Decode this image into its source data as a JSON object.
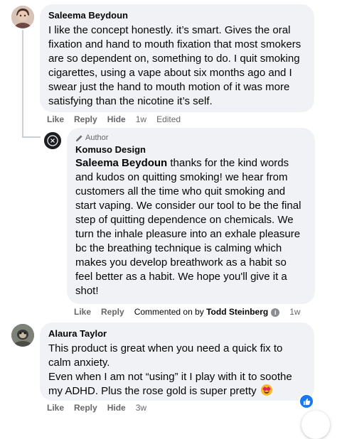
{
  "comments": [
    {
      "author": "Saleema Beydoun",
      "text": "I like the concept honestly. it’s smart. Gives the oral fixation and hand to mouth fixation that most smokers are so dependent on, something to do. I quit smoking cigarettes, using a vape about six months ago and I swear just the hand to mouth motion of it was more satisfying than the nicotine it’s self.",
      "actions": {
        "like": "Like",
        "reply": "Reply",
        "hide": "Hide",
        "time": "1w",
        "edited": "Edited"
      }
    },
    {
      "badge": "Author",
      "author": "Komuso Design",
      "mention": "Saleema Beydoun",
      "text": " thanks for the kind words and kudos on quitting smoking! we hear from customers all the time who quit smoking and start vaping. We consider our tool to be the final step of quitting dependence on chemicals. We turn the inhale pleasure into an exhale pleasure bc the breathing technique is calming which makes you develop breathwork as a habit so feel better as a habit. We hope you'll give it a shot!",
      "actions": {
        "like": "Like",
        "reply": "Reply",
        "commented_on_by": "Commented on by",
        "commenter": "Todd Steinberg",
        "info": "i",
        "time": "1w"
      }
    },
    {
      "author": "Alaura Taylor",
      "text": "This product is great when you need a quick fix to calm anxiety.\nEven when I am not “using” it I play with it to soothe my ADHD. Plus the rose gold is super pretty",
      "emoji": "heart-eyes-emoji",
      "actions": {
        "like": "Like",
        "reply": "Reply",
        "hide": "Hide",
        "time": "3w"
      },
      "reaction": "like"
    }
  ],
  "icons": {
    "pencil": "pencil-icon",
    "info": "info-icon",
    "like_reaction": "thumbs-up-icon",
    "page_logo": "komuso-logo-icon"
  },
  "colors": {
    "bubble": "#f0f2f5",
    "meta_text": "#65676b",
    "like_blue": "#1877f2"
  }
}
